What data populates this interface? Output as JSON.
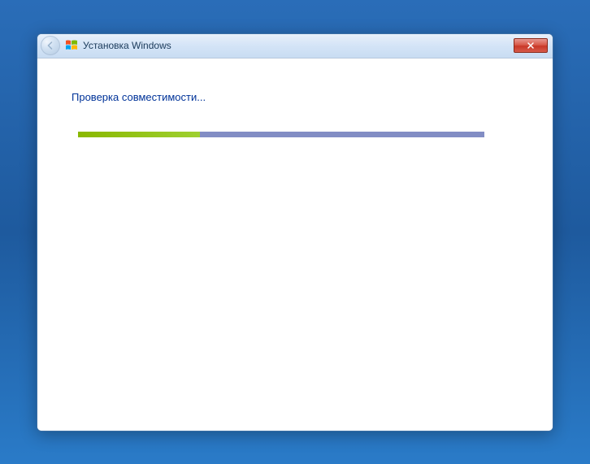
{
  "window": {
    "title": "Установка Windows"
  },
  "content": {
    "status_text": "Проверка совместимости...",
    "progress_percent": 30
  },
  "colors": {
    "progress_fill": "#9ed030",
    "progress_track": "#828dc4",
    "title_text": "#003399"
  }
}
